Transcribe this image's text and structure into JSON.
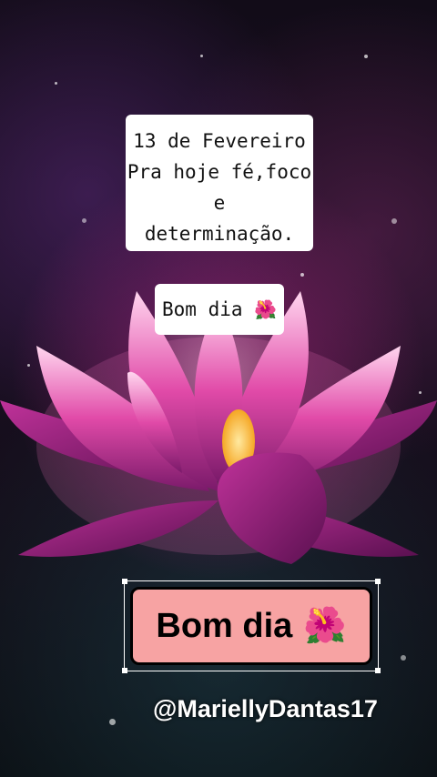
{
  "card": {
    "line1": "13 de Fevereiro",
    "line2": "Pra hoje fé,foco e",
    "line3": "determinação."
  },
  "greeting_small": "Bom dia",
  "sticker": {
    "label": "Bom dia"
  },
  "username": "@MariellyDantas17",
  "icons": {
    "greeting_small_icon": "hibiscus-icon",
    "sticker_icon": "hibiscus-icon",
    "hibiscus_glyph": "🌺"
  },
  "colors": {
    "sticker_bg": "#f7a3a3",
    "lotus_pink": "#e14aa8"
  }
}
